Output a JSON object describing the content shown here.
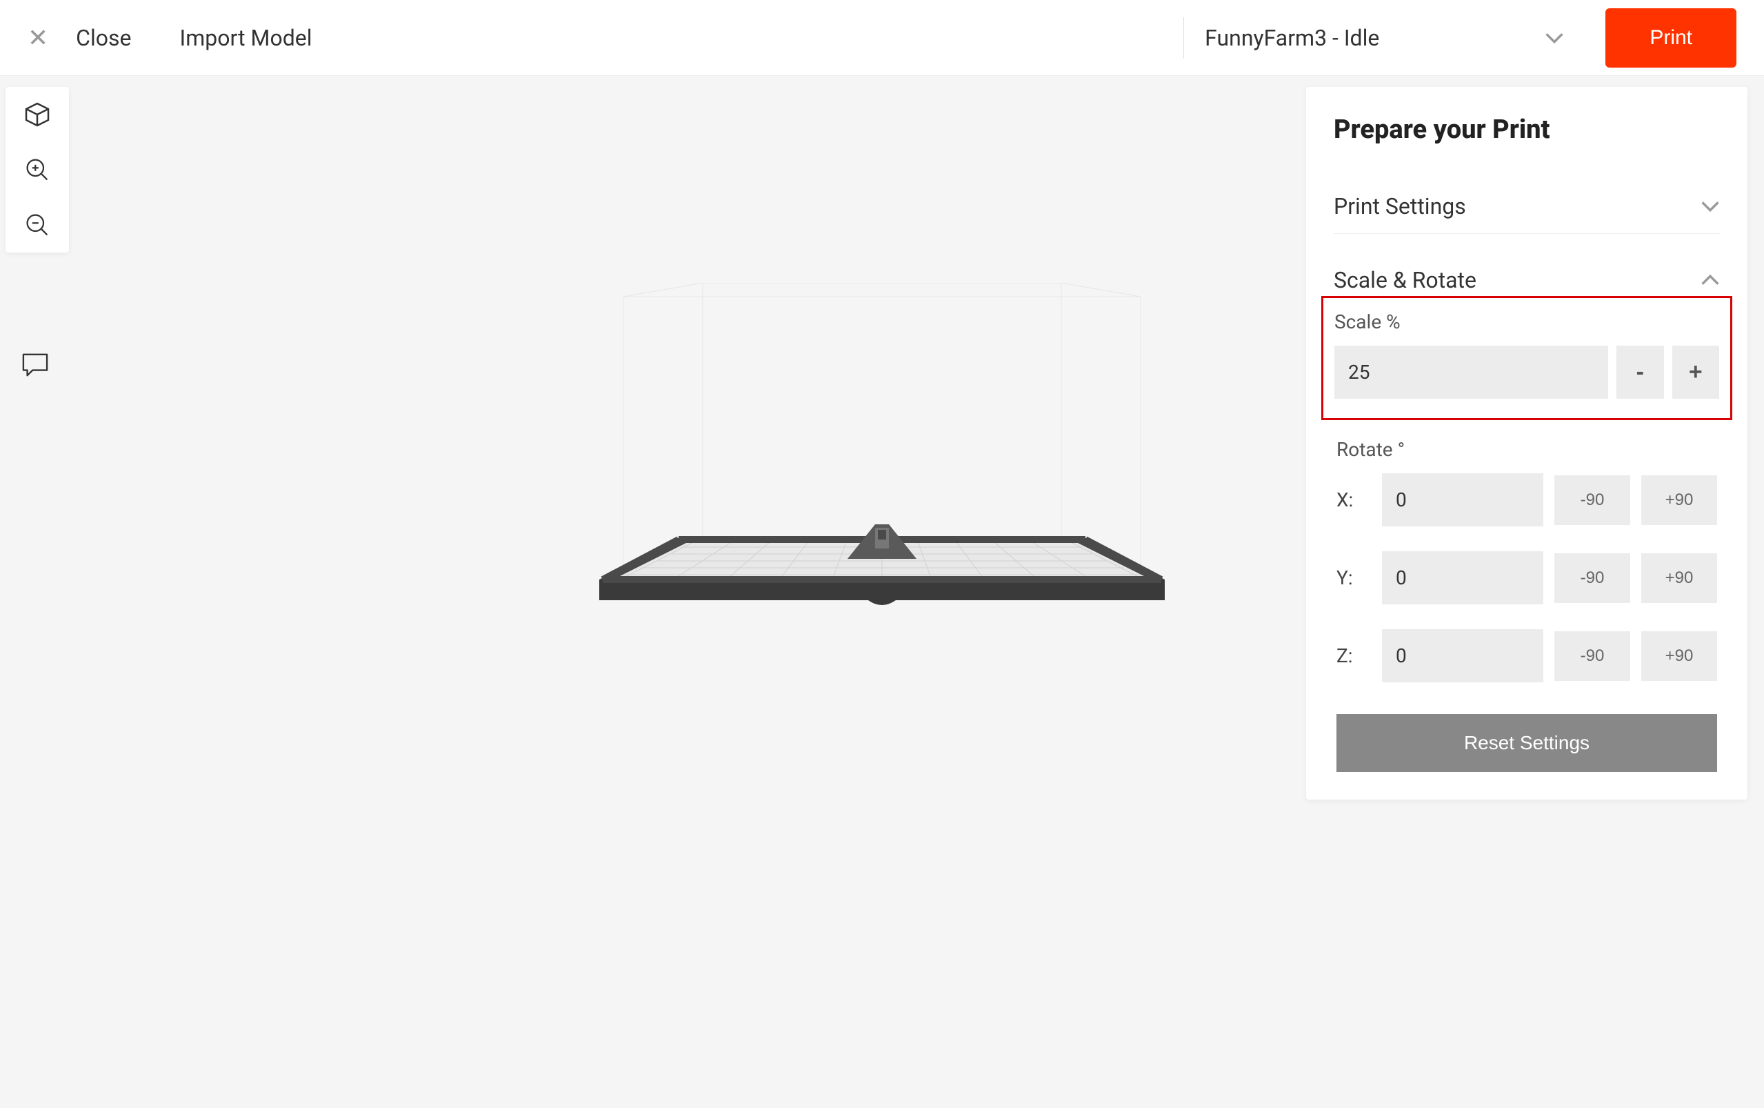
{
  "toolbar": {
    "close_label": "Close",
    "import_label": "Import Model",
    "printer_name": "FunnyFarm3 - Idle",
    "print_label": "Print"
  },
  "panel": {
    "title": "Prepare your Print",
    "sections": {
      "print_settings": "Print Settings",
      "scale_rotate": "Scale & Rotate"
    },
    "scale": {
      "label": "Scale %",
      "value": "25",
      "minus": "-",
      "plus": "+"
    },
    "rotate": {
      "label": "Rotate °",
      "axes": [
        {
          "axis": "X:",
          "value": "0",
          "minus90": "-90",
          "plus90": "+90"
        },
        {
          "axis": "Y:",
          "value": "0",
          "minus90": "-90",
          "plus90": "+90"
        },
        {
          "axis": "Z:",
          "value": "0",
          "minus90": "-90",
          "plus90": "+90"
        }
      ]
    },
    "reset_label": "Reset Settings"
  }
}
